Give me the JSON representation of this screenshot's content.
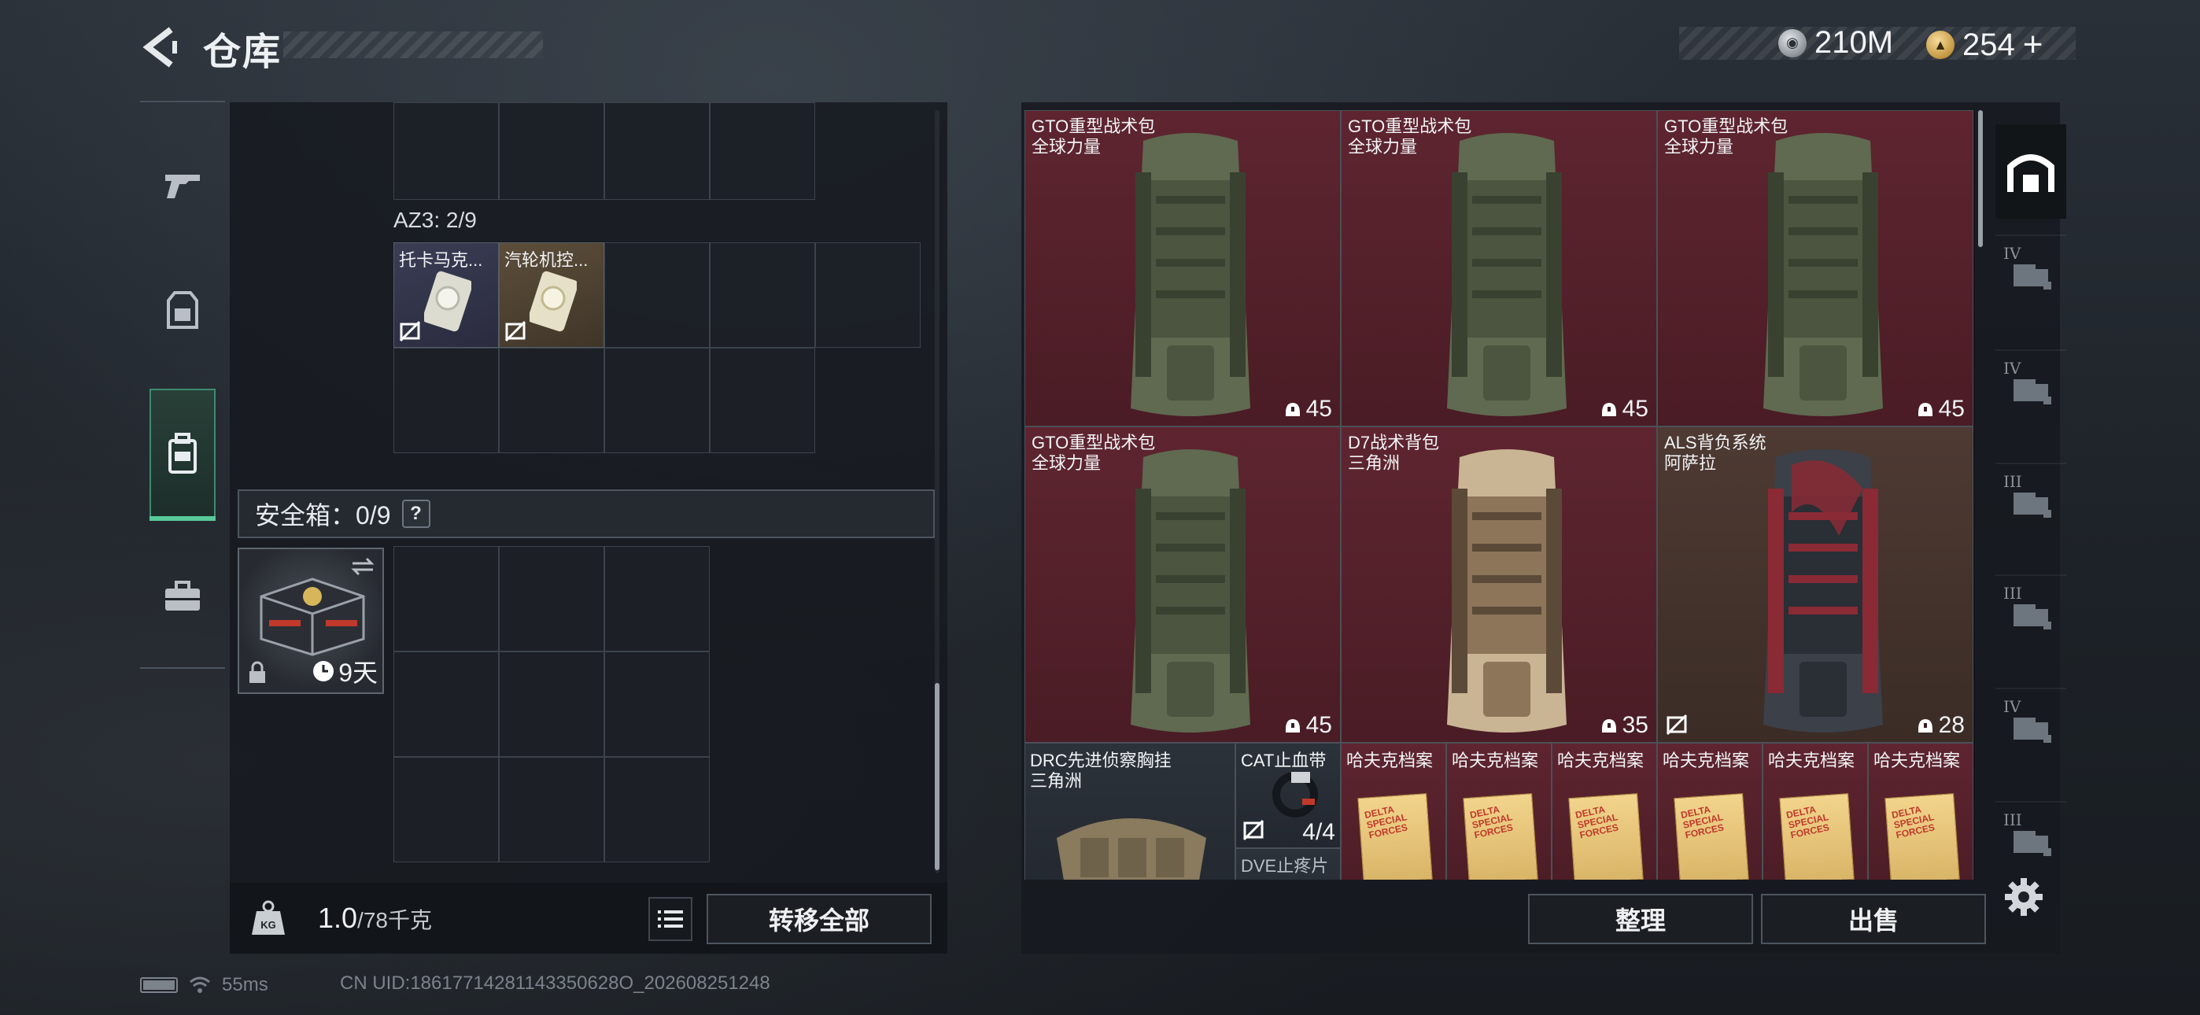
{
  "header": {
    "title": "仓库",
    "currencies": [
      {
        "icon": "silver-coin-icon",
        "value": "210M"
      },
      {
        "icon": "gold-coin-icon",
        "value": "254"
      }
    ],
    "add_symbol": "+"
  },
  "left_tabs": [
    {
      "name": "weapons",
      "icon": "pistol-icon",
      "active": false
    },
    {
      "name": "equipment",
      "icon": "armor-icon",
      "active": false
    },
    {
      "name": "backpack",
      "icon": "backpack-icon",
      "active": true
    },
    {
      "name": "supplies",
      "icon": "toolbox-icon",
      "active": false
    }
  ],
  "inventory": {
    "az3_label": "AZ3: 2/9",
    "items": [
      {
        "name": "托卡马克...",
        "restricted": true
      },
      {
        "name": "汽轮机控...",
        "restricted": true
      }
    ],
    "safe_box_label": "安全箱：0/9",
    "help": "?",
    "safe_box_item": {
      "duration": "9天",
      "locked": true
    }
  },
  "footer_left": {
    "weight_value": "1.0",
    "weight_max": "/78千克",
    "transfer_all": "转移全部"
  },
  "storage": {
    "bags": [
      {
        "line1": "GTO重型战术包",
        "line2": "全球力量",
        "capacity": "45",
        "color": "red",
        "restricted": false
      },
      {
        "line1": "GTO重型战术包",
        "line2": "全球力量",
        "capacity": "45",
        "color": "red",
        "restricted": false
      },
      {
        "line1": "GTO重型战术包",
        "line2": "全球力量",
        "capacity": "45",
        "color": "red",
        "restricted": false
      },
      {
        "line1": "GTO重型战术包",
        "line2": "全球力量",
        "capacity": "45",
        "color": "red",
        "restricted": false
      },
      {
        "line1": "D7战术背包",
        "line2": "三角洲",
        "capacity": "35",
        "color": "red",
        "restricted": false
      },
      {
        "line1": "ALS背负系统",
        "line2": "阿萨拉",
        "capacity": "28",
        "color": "brown",
        "restricted": true
      }
    ],
    "chest_rig": {
      "line1": "DRC先进侦察胸挂",
      "line2": "三角洲"
    },
    "tourniquet": {
      "name": "CAT止血带",
      "count": "4/4",
      "next_name": "DVE止疼片"
    },
    "files": [
      {
        "name": "哈夫克档案",
        "stamp": "DELTA SPECIAL FORCES"
      },
      {
        "name": "哈夫克档案",
        "stamp": "DELTA SPECIAL FORCES"
      },
      {
        "name": "哈夫克档案",
        "stamp": "DELTA SPECIAL FORCES"
      },
      {
        "name": "哈夫克档案",
        "stamp": "DELTA SPECIAL FORCES"
      },
      {
        "name": "哈夫克档案",
        "stamp": "DELTA SPECIAL FORCES"
      },
      {
        "name": "哈夫克档案",
        "stamp": "DELTA SPECIAL FORCES"
      }
    ],
    "sort_label": "整理",
    "sell_label": "出售"
  },
  "right_tabs": [
    {
      "icon": "safe-house-icon",
      "tier": "",
      "active": true
    },
    {
      "icon": "folder-crate-icon",
      "tier": "IV",
      "active": false
    },
    {
      "icon": "medkit-crate-icon",
      "tier": "IV",
      "active": false
    },
    {
      "icon": "rifle-crate-icon",
      "tier": "III",
      "active": false
    },
    {
      "icon": "rifle-crate-icon",
      "tier": "III",
      "active": false
    },
    {
      "icon": "gear-crate-icon",
      "tier": "IV",
      "active": false
    },
    {
      "icon": "rifle-crate-icon",
      "tier": "III",
      "active": false
    }
  ],
  "status": {
    "ping": "55ms",
    "uid": "CN UID:18617714281143350628O_202608251248"
  },
  "colors": {
    "accent_green": "#57c99a",
    "card_red": "#5e2530",
    "card_brown": "#4e3a33",
    "coin_gold": "#c3963f"
  }
}
